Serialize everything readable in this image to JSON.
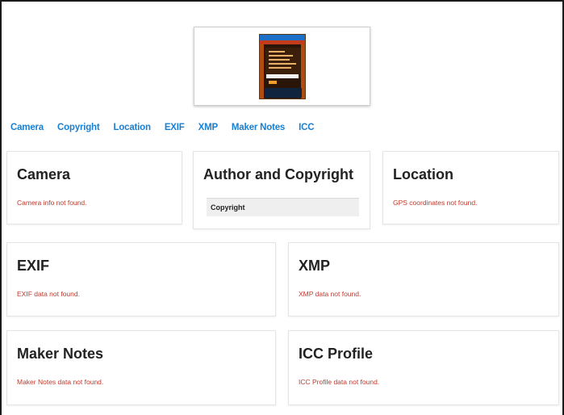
{
  "nav": {
    "links": [
      "Camera",
      "Copyright",
      "Location",
      "EXIF",
      "XMP",
      "Maker Notes",
      "ICC"
    ]
  },
  "cards": {
    "camera": {
      "title": "Camera",
      "message": "Camera info not found."
    },
    "copyright": {
      "title": "Author and Copyright",
      "row_label": "Copyright"
    },
    "location": {
      "title": "Location",
      "message": "GPS coordinates not found."
    },
    "exif": {
      "title": "EXIF",
      "message": "EXIF data not found."
    },
    "xmp": {
      "title": "XMP",
      "message": "XMP data not found."
    },
    "maker": {
      "title": "Maker Notes",
      "message": "Maker Notes data not found."
    },
    "icc": {
      "title": "ICC Profile",
      "message": "ICC Profile data not found."
    }
  },
  "colors": {
    "link": "#1a7fd1",
    "error": "#c0392b"
  }
}
